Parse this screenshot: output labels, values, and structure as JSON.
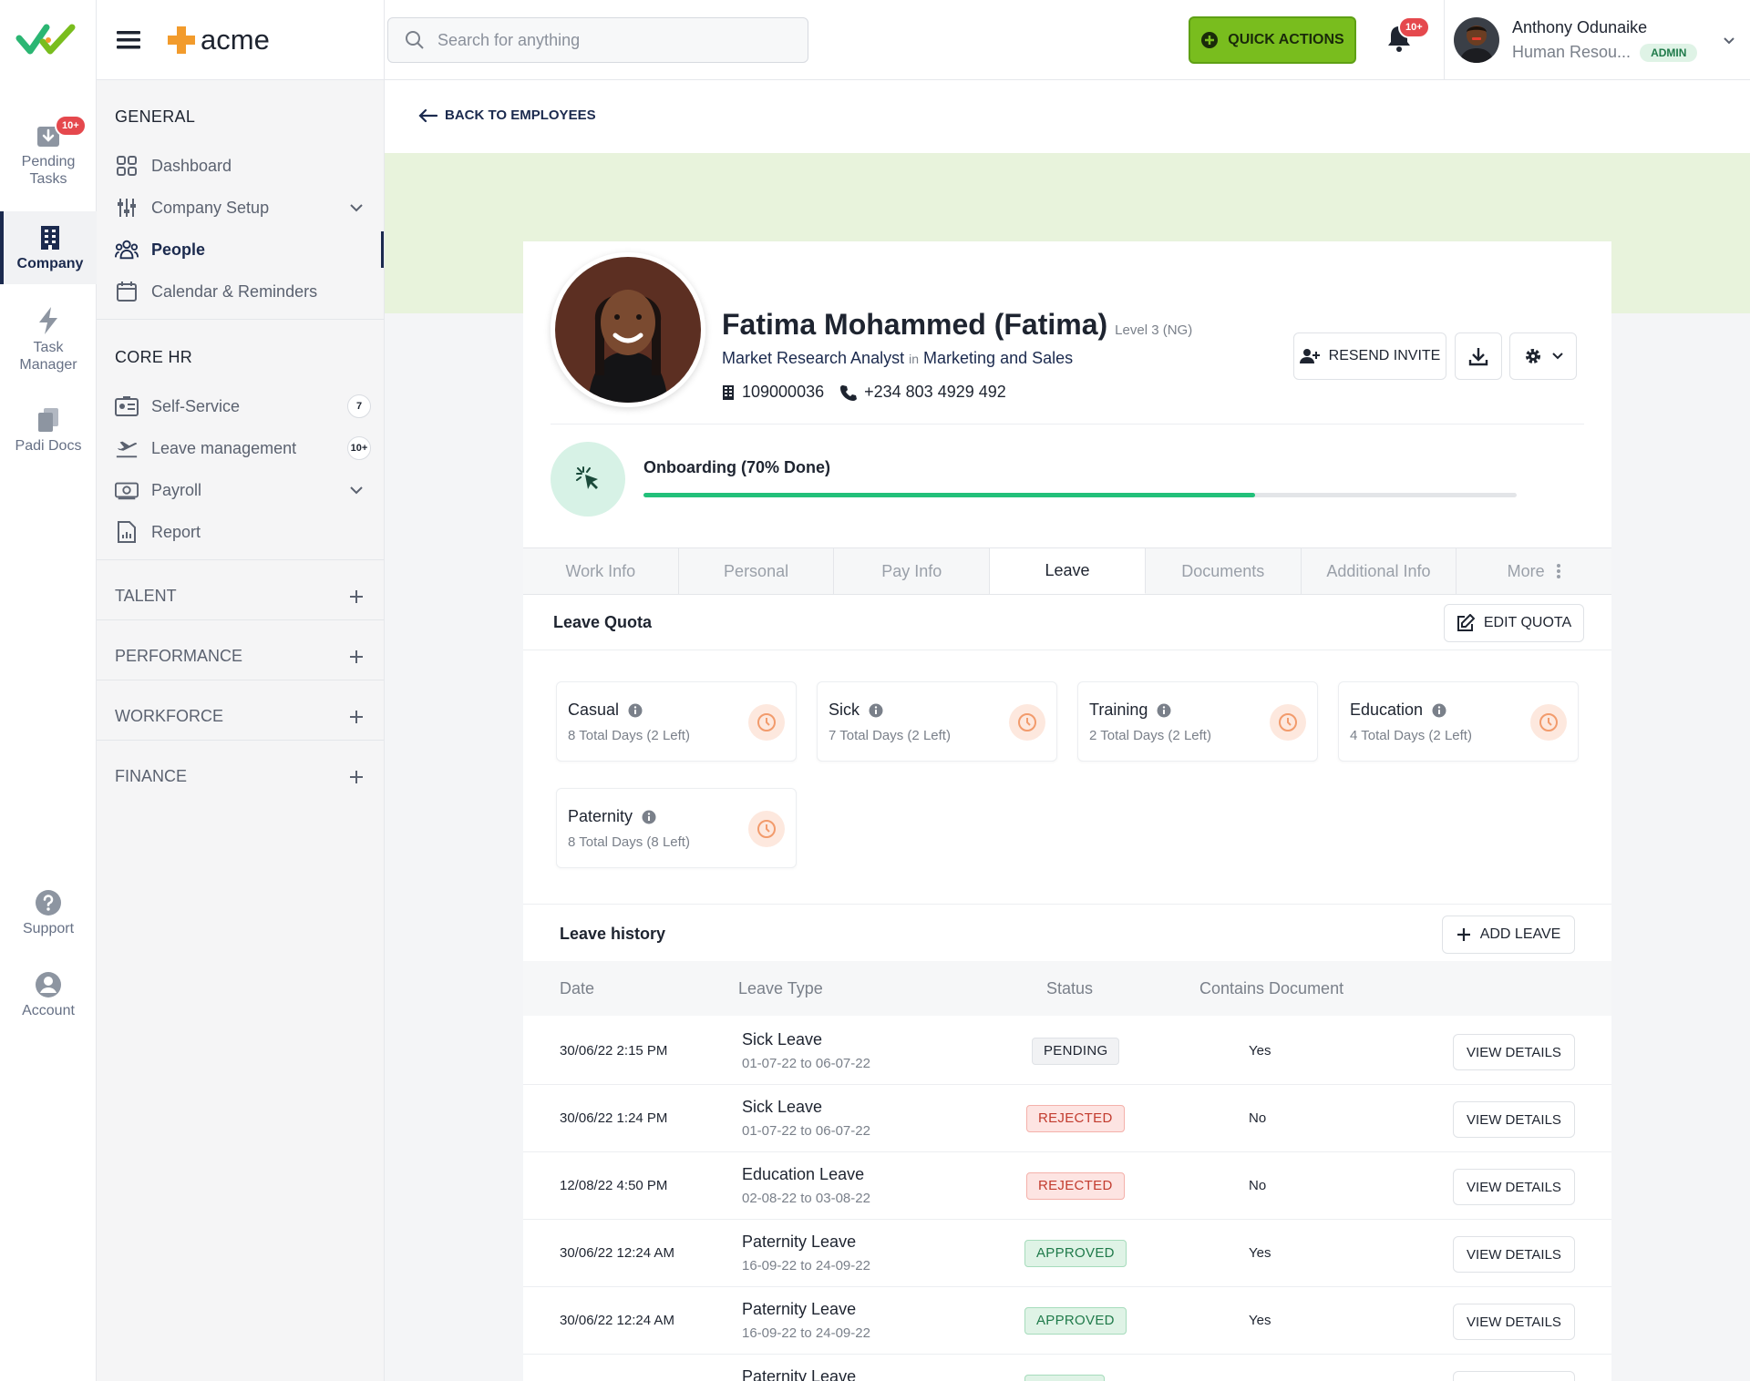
{
  "rail": {
    "pending_tasks": "Pending Tasks",
    "pending_badge": "10+",
    "company": "Company",
    "task_manager": "Task Manager",
    "padi_docs": "Padi Docs",
    "support": "Support",
    "account": "Account"
  },
  "brand": {
    "name": "acme"
  },
  "sidebar": {
    "general_title": "GENERAL",
    "general": [
      {
        "label": "Dashboard"
      },
      {
        "label": "Company Setup"
      },
      {
        "label": "People"
      },
      {
        "label": "Calendar & Reminders"
      }
    ],
    "core_title": "CORE HR",
    "core": [
      {
        "label": "Self-Service",
        "count": "7"
      },
      {
        "label": "Leave management",
        "count": "10+"
      },
      {
        "label": "Payroll"
      },
      {
        "label": "Report"
      }
    ],
    "groups": [
      "TALENT",
      "PERFORMANCE",
      "WORKFORCE",
      "FINANCE"
    ]
  },
  "header": {
    "search_placeholder": "Search for anything",
    "quick_actions": "QUICK ACTIONS",
    "notif_badge": "10+",
    "user_name": "Anthony Odunaike",
    "user_role": "Human Resou...",
    "user_badge": "ADMIN"
  },
  "back_link": "BACK TO EMPLOYEES",
  "profile": {
    "name": "Fatima Mohammed (Fatima)",
    "level": "Level 3 (NG)",
    "role": "Market Research Analyst",
    "in_word": "in",
    "department": "Marketing and Sales",
    "employee_id": "109000036",
    "phone": "+234 803 4929 492",
    "resend_invite": "RESEND INVITE"
  },
  "onboarding": {
    "label": "Onboarding (70% Done)",
    "progress": 0.7
  },
  "tabs": [
    "Work Info",
    "Personal",
    "Pay Info",
    "Leave",
    "Documents",
    "Additional Info",
    "More"
  ],
  "active_tab": 3,
  "leave_quota": {
    "title": "Leave Quota",
    "edit_label": "EDIT QUOTA",
    "items": [
      {
        "name": "Casual",
        "detail": "8 Total Days (2 Left)"
      },
      {
        "name": "Sick",
        "detail": "7 Total Days (2 Left)"
      },
      {
        "name": "Training",
        "detail": "2 Total Days (2 Left)"
      },
      {
        "name": "Education",
        "detail": "4 Total Days (2 Left)"
      },
      {
        "name": "Paternity",
        "detail": "8 Total Days (8 Left)"
      }
    ]
  },
  "leave_history": {
    "title": "Leave history",
    "add_label": "ADD LEAVE",
    "columns": [
      "Date",
      "Leave Type",
      "Status",
      "Contains Document"
    ],
    "view_label": "VIEW DETAILS",
    "rows": [
      {
        "date": "30/06/22 2:15 PM",
        "type": "Sick Leave",
        "range": "01-07-22 to 06-07-22",
        "status": "PENDING",
        "status_kind": "pending",
        "doc": "Yes"
      },
      {
        "date": "30/06/22 1:24 PM",
        "type": "Sick Leave",
        "range": "01-07-22 to 06-07-22",
        "status": "REJECTED",
        "status_kind": "rejected",
        "doc": "No"
      },
      {
        "date": "12/08/22 4:50 PM",
        "type": "Education Leave",
        "range": "02-08-22 to 03-08-22",
        "status": "REJECTED",
        "status_kind": "rejected",
        "doc": "No"
      },
      {
        "date": "30/06/22 12:24 AM",
        "type": "Paternity Leave",
        "range": "16-09-22 to 24-09-22",
        "status": "APPROVED",
        "status_kind": "approved",
        "doc": "Yes"
      },
      {
        "date": "30/06/22 12:24 AM",
        "type": "Paternity Leave",
        "range": "16-09-22 to 24-09-22",
        "status": "APPROVED",
        "status_kind": "approved",
        "doc": "Yes"
      },
      {
        "date": "",
        "type": "Paternity Leave",
        "range": "",
        "status": "",
        "status_kind": "approved",
        "doc": ""
      }
    ]
  },
  "colors": {
    "brand_green": "#79bd1e",
    "navy": "#1b2a4e",
    "accent_orange": "#f29b2c"
  }
}
